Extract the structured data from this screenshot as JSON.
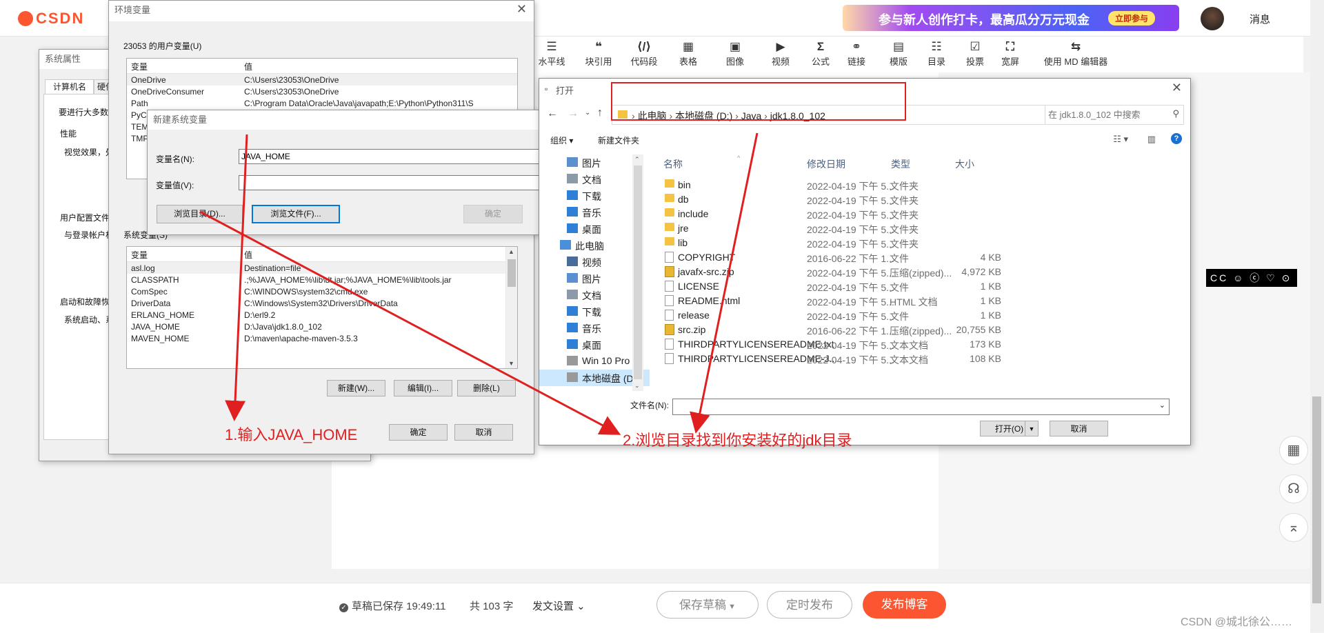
{
  "csdn": {
    "logo_text": "CSDN",
    "promo_text": "参与新人创作打卡，最高瓜分万元现金",
    "promo_button": "立即参与",
    "messages_label": "消息",
    "toolbar": [
      {
        "icon": "horizontal-line-icon",
        "glyph": "☰",
        "label": "水平线"
      },
      {
        "icon": "quote-icon",
        "glyph": "❝",
        "label": "块引用"
      },
      {
        "icon": "code-icon",
        "glyph": "⟨/⟩",
        "label": "代码段"
      },
      {
        "icon": "table-icon",
        "glyph": "▦",
        "label": "表格"
      },
      {
        "icon": "image-icon",
        "glyph": "▣",
        "label": "图像"
      },
      {
        "icon": "video-icon",
        "glyph": "▶",
        "label": "视频"
      },
      {
        "icon": "formula-icon",
        "glyph": "Σ",
        "label": "公式"
      },
      {
        "icon": "link-icon",
        "glyph": "⚭",
        "label": "链接"
      },
      {
        "icon": "template-icon",
        "glyph": "▤",
        "label": "模版"
      },
      {
        "icon": "toc-icon",
        "glyph": "☷",
        "label": "目录"
      },
      {
        "icon": "vote-icon",
        "glyph": "☑",
        "label": "投票"
      },
      {
        "icon": "fullscreen-icon",
        "glyph": "⛶",
        "label": "宽屏"
      },
      {
        "icon": "md-editor-icon",
        "glyph": "⇆",
        "label": "使用 MD 编辑器"
      }
    ],
    "badge_cc": "CC ☺ ⓒ ♡ ⊙",
    "bottom": {
      "saved": "草稿已保存 19:49:11",
      "word_count": "共 103 字",
      "publish_settings": "发文设置",
      "save_draft": "保存草稿",
      "timed_publish": "定时发布",
      "publish": "发布博客"
    },
    "watermark": "CSDN @城北徐公……"
  },
  "sysprops": {
    "title": "系统属性",
    "tabs": [
      "计算机名",
      "硬件"
    ],
    "intro": "要进行大多数",
    "group_performance": "性能",
    "performance_text": "视觉效果，处",
    "group_profiles": "用户配置文件",
    "profiles_text": "与登录帐户相",
    "group_startup": "启动和故障恢",
    "startup_text": "系统启动、系"
  },
  "envvars": {
    "title": "环境变量",
    "user_section": "23053 的用户变量(U)",
    "col_var": "变量",
    "col_val": "值",
    "user_rows": [
      {
        "name": "OneDrive",
        "value": "C:\\Users\\23053\\OneDrive"
      },
      {
        "name": "OneDriveConsumer",
        "value": "C:\\Users\\23053\\OneDrive"
      },
      {
        "name": "Path",
        "value": "C:\\Program Data\\Oracle\\Java\\javapath;E:\\Python\\Python311\\S"
      },
      {
        "name": "PyCharm",
        "value": ""
      },
      {
        "name": "TEMP",
        "value": ""
      },
      {
        "name": "TMP",
        "value": ""
      }
    ],
    "system_section": "系统变量(S)",
    "system_rows": [
      {
        "name": "asl.log",
        "value": "Destination=file"
      },
      {
        "name": "CLASSPATH",
        "value": ".;%JAVA_HOME%\\lib\\dt.jar;%JAVA_HOME%\\lib\\tools.jar"
      },
      {
        "name": "ComSpec",
        "value": "C:\\WINDOWS\\system32\\cmd.exe"
      },
      {
        "name": "DriverData",
        "value": "C:\\Windows\\System32\\Drivers\\DriverData"
      },
      {
        "name": "ERLANG_HOME",
        "value": "D:\\erl9.2"
      },
      {
        "name": "JAVA_HOME",
        "value": "D:\\Java\\jdk1.8.0_102"
      },
      {
        "name": "MAVEN_HOME",
        "value": "D:\\maven\\apache-maven-3.5.3"
      }
    ],
    "btn_new": "新建(W)...",
    "btn_edit": "编辑(I)...",
    "btn_delete": "删除(L)",
    "btn_ok": "确定",
    "btn_cancel": "取消"
  },
  "newvar": {
    "title": "新建系统变量",
    "name_label": "变量名(N):",
    "name_value": "JAVA_HOME",
    "value_label": "变量值(V):",
    "value_value": "",
    "btn_browse_dir": "浏览目录(D)...",
    "btn_browse_file": "浏览文件(F)...",
    "btn_ok": "确定"
  },
  "filedlg": {
    "title": "打开",
    "breadcrumb": [
      "此电脑",
      "本地磁盘 (D:)",
      "Java",
      "jdk1.8.0_102"
    ],
    "search_placeholder": "在 jdk1.8.0_102 中搜索",
    "organize": "组织 ▾",
    "new_folder": "新建文件夹",
    "nav": [
      {
        "icon": "pictures-icon",
        "label": "图片",
        "indent": 1
      },
      {
        "icon": "documents-icon",
        "label": "文档",
        "indent": 1
      },
      {
        "icon": "downloads-icon",
        "label": "下载",
        "indent": 1
      },
      {
        "icon": "music-icon",
        "label": "音乐",
        "indent": 1
      },
      {
        "icon": "desktop-icon",
        "label": "桌面",
        "indent": 1
      },
      {
        "icon": "this-pc-icon",
        "label": "此电脑",
        "indent": 0
      },
      {
        "icon": "videos-icon",
        "label": "视频",
        "indent": 1
      },
      {
        "icon": "pictures-icon",
        "label": "图片",
        "indent": 1
      },
      {
        "icon": "documents-icon",
        "label": "文档",
        "indent": 1
      },
      {
        "icon": "downloads-icon",
        "label": "下载",
        "indent": 1
      },
      {
        "icon": "music-icon",
        "label": "音乐",
        "indent": 1
      },
      {
        "icon": "desktop-icon",
        "label": "桌面",
        "indent": 1
      },
      {
        "icon": "drive-icon",
        "label": "Win 10 Pro",
        "indent": 1
      },
      {
        "icon": "drive-icon",
        "label": "本地磁盘 (D:",
        "indent": 1
      }
    ],
    "columns": [
      "名称",
      "修改日期",
      "类型",
      "大小"
    ],
    "files": [
      {
        "kind": "folder",
        "name": "bin",
        "date": "2022-04-19 下午 5...",
        "type": "文件夹",
        "size": ""
      },
      {
        "kind": "folder",
        "name": "db",
        "date": "2022-04-19 下午 5...",
        "type": "文件夹",
        "size": ""
      },
      {
        "kind": "folder",
        "name": "include",
        "date": "2022-04-19 下午 5...",
        "type": "文件夹",
        "size": ""
      },
      {
        "kind": "folder",
        "name": "jre",
        "date": "2022-04-19 下午 5...",
        "type": "文件夹",
        "size": ""
      },
      {
        "kind": "folder",
        "name": "lib",
        "date": "2022-04-19 下午 5...",
        "type": "文件夹",
        "size": ""
      },
      {
        "kind": "file",
        "name": "COPYRIGHT",
        "date": "2016-06-22 下午 1...",
        "type": "文件",
        "size": "4 KB"
      },
      {
        "kind": "zip",
        "name": "javafx-src.zip",
        "date": "2022-04-19 下午 5...",
        "type": "压缩(zipped)...",
        "size": "4,972 KB"
      },
      {
        "kind": "file",
        "name": "LICENSE",
        "date": "2022-04-19 下午 5...",
        "type": "文件",
        "size": "1 KB"
      },
      {
        "kind": "html",
        "name": "README.html",
        "date": "2022-04-19 下午 5...",
        "type": "HTML 文档",
        "size": "1 KB"
      },
      {
        "kind": "file",
        "name": "release",
        "date": "2022-04-19 下午 5...",
        "type": "文件",
        "size": "1 KB"
      },
      {
        "kind": "zip",
        "name": "src.zip",
        "date": "2016-06-22 下午 1...",
        "type": "压缩(zipped)...",
        "size": "20,755 KB"
      },
      {
        "kind": "file",
        "name": "THIRDPARTYLICENSEREADME.txt",
        "date": "2022-04-19 下午 5...",
        "type": "文本文档",
        "size": "173 KB"
      },
      {
        "kind": "file",
        "name": "THIRDPARTYLICENSEREADME-J...",
        "date": "2022-04-19 下午 5...",
        "type": "文本文档",
        "size": "108 KB"
      }
    ],
    "filename_label": "文件名(N):",
    "filename_value": "",
    "btn_open": "打开(O)",
    "btn_cancel": "取消"
  },
  "annotations": {
    "step1": "1.输入JAVA_HOME",
    "step2": "2.浏览目录找到你安装好的jdk目录",
    "color": "#e02020"
  }
}
